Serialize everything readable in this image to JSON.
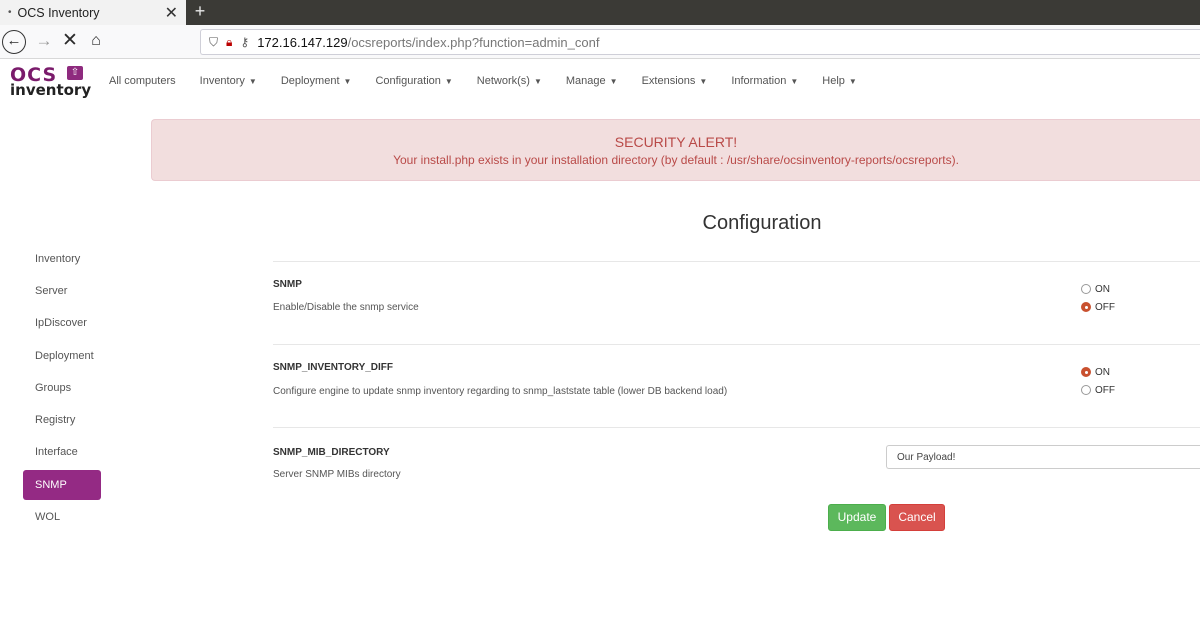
{
  "browser": {
    "tab_title": "OCS Inventory",
    "tab_close": "✕",
    "new_tab": "+",
    "url_host": "172.16.147.129",
    "url_path": "/ocsreports/index.php?function=admin_conf"
  },
  "logo": {
    "top": "OCS",
    "bottom": "inventory"
  },
  "menu": [
    {
      "label": "All computers",
      "dropdown": false
    },
    {
      "label": "Inventory",
      "dropdown": true
    },
    {
      "label": "Deployment",
      "dropdown": true
    },
    {
      "label": "Configuration",
      "dropdown": true
    },
    {
      "label": "Network(s)",
      "dropdown": true
    },
    {
      "label": "Manage",
      "dropdown": true
    },
    {
      "label": "Extensions",
      "dropdown": true
    },
    {
      "label": "Information",
      "dropdown": true
    },
    {
      "label": "Help",
      "dropdown": true
    }
  ],
  "alert": {
    "title": "SECURITY ALERT!",
    "message": "Your install.php exists in your installation directory (by default : /usr/share/ocsinventory-reports/ocsreports)."
  },
  "page_title": "Configuration",
  "sidebar": {
    "items": [
      "Inventory",
      "Server",
      "IpDiscover",
      "Deployment",
      "Groups",
      "Registry",
      "Interface",
      "SNMP",
      "WOL"
    ],
    "active": "SNMP"
  },
  "settings": {
    "snmp": {
      "name": "SNMP",
      "description": "Enable/Disable the snmp service",
      "on_label": "ON",
      "off_label": "OFF",
      "value": "OFF"
    },
    "snmp_inventory_diff": {
      "name": "SNMP_INVENTORY_DIFF",
      "description": "Configure engine to update snmp inventory regarding to snmp_laststate table (lower DB backend load)",
      "on_label": "ON",
      "off_label": "OFF",
      "value": "ON"
    },
    "snmp_mib_directory": {
      "name": "SNMP_MIB_DIRECTORY",
      "description": "Server SNMP MIBs directory",
      "value": "Our Payload!"
    }
  },
  "buttons": {
    "update": "Update",
    "cancel": "Cancel"
  },
  "colors": {
    "accent": "#942a84",
    "alert_bg": "#f2dede",
    "alert_text": "#b94a48",
    "update": "#5cb85c",
    "cancel": "#d9534f",
    "radio_checked": "#c9512f"
  }
}
